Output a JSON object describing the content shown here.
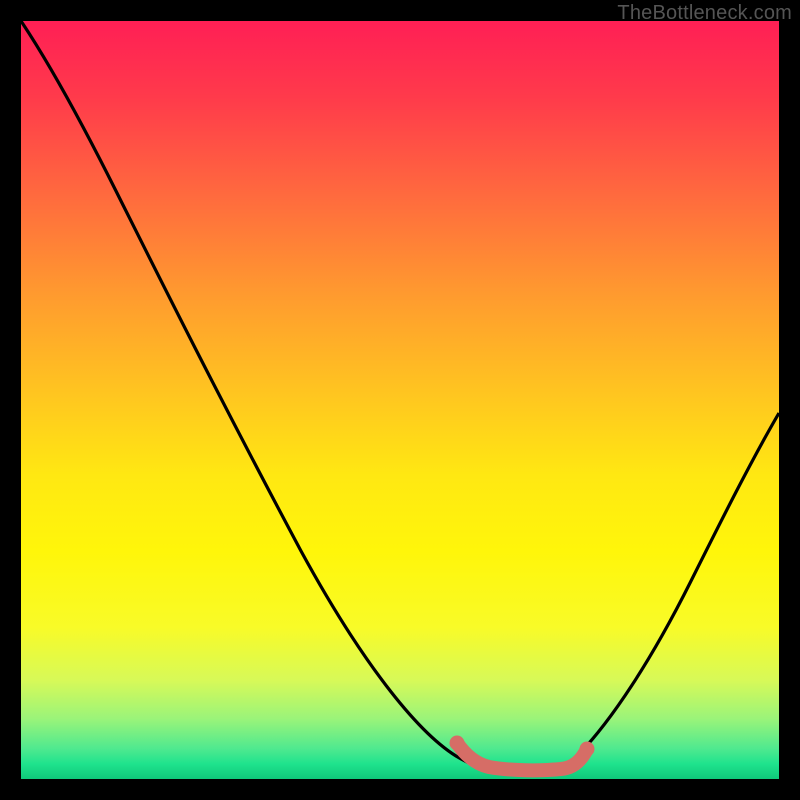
{
  "attribution": "TheBottleneck.com",
  "colors": {
    "background": "#000000",
    "gradient_top": "#ff1f55",
    "gradient_mid": "#ffe812",
    "gradient_bottom": "#0fc87a",
    "curve": "#000000",
    "highlight": "#d66d66"
  },
  "chart_data": {
    "type": "line",
    "title": "",
    "xlabel": "",
    "ylabel": "",
    "xlim": [
      0,
      100
    ],
    "ylim": [
      0,
      100
    ],
    "grid": false,
    "legend": false,
    "series": [
      {
        "name": "left-branch",
        "x": [
          0,
          6,
          12,
          18,
          24,
          30,
          36,
          42,
          48,
          54,
          58,
          60
        ],
        "values": [
          100,
          96,
          88,
          78,
          67,
          56,
          45,
          34,
          23,
          12,
          5,
          3
        ]
      },
      {
        "name": "right-branch",
        "x": [
          73,
          77,
          81,
          85,
          89,
          93,
          97,
          100
        ],
        "values": [
          4,
          10,
          18,
          26,
          34,
          42,
          48,
          52
        ]
      },
      {
        "name": "valley-highlight",
        "x": [
          58,
          60,
          63,
          66,
          69,
          72,
          73,
          74
        ],
        "values": [
          5,
          3,
          2.5,
          2.5,
          2.5,
          3,
          4,
          6
        ]
      }
    ],
    "annotations": []
  }
}
